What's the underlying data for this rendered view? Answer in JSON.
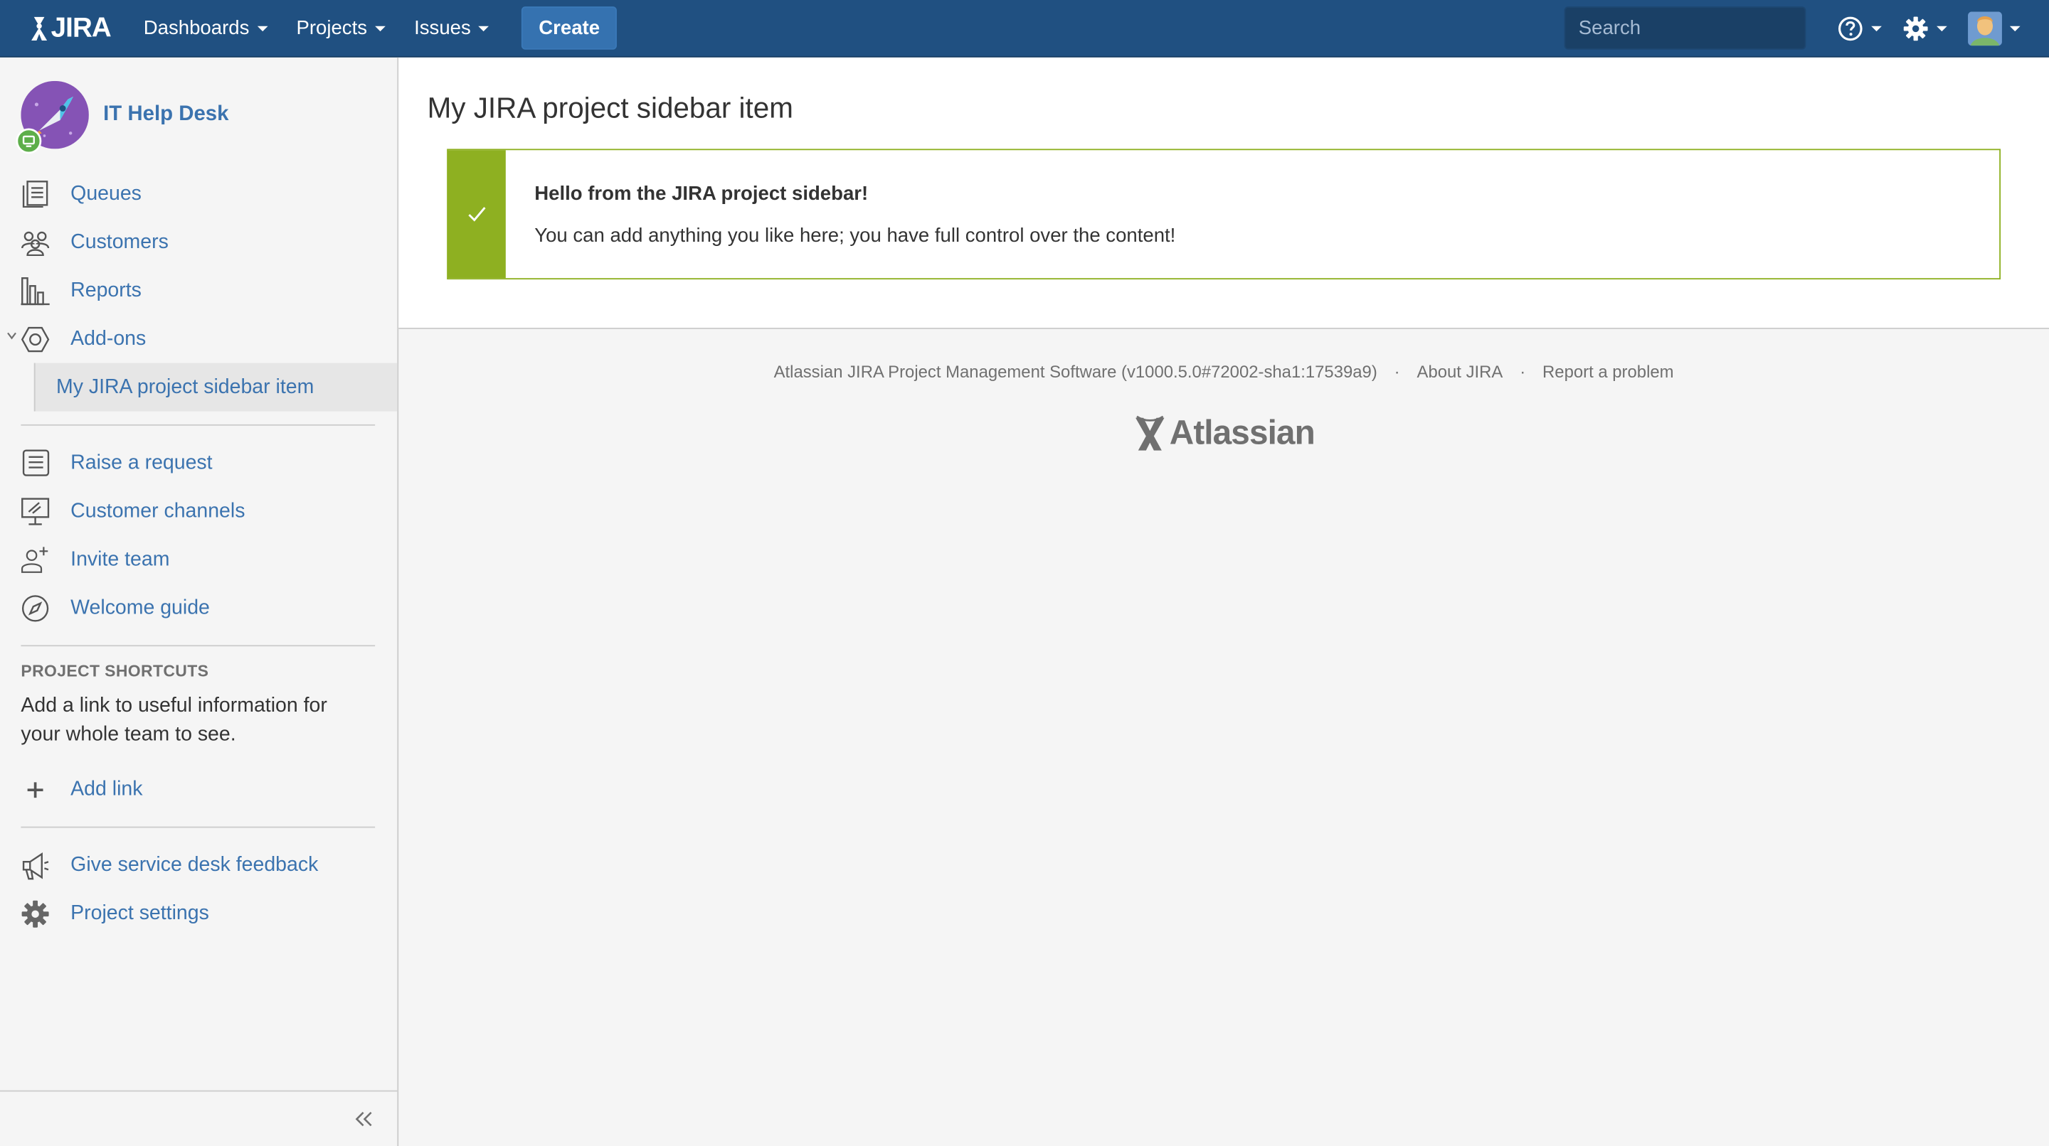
{
  "topnav": {
    "logo_text": "JIRA",
    "menus": [
      {
        "label": "Dashboards"
      },
      {
        "label": "Projects"
      },
      {
        "label": "Issues"
      }
    ],
    "create_label": "Create",
    "search_placeholder": "Search",
    "colors": {
      "bar": "#205081",
      "create": "#3572b0"
    }
  },
  "sidebar": {
    "project_name": "IT Help Desk",
    "items": [
      {
        "label": "Queues",
        "icon": "queues-icon"
      },
      {
        "label": "Customers",
        "icon": "customers-icon"
      },
      {
        "label": "Reports",
        "icon": "reports-icon"
      },
      {
        "label": "Add-ons",
        "icon": "addons-icon"
      }
    ],
    "active_sub_item": "My JIRA project sidebar item",
    "secondary_items": [
      {
        "label": "Raise a request",
        "icon": "raise-request-icon"
      },
      {
        "label": "Customer channels",
        "icon": "customer-channels-icon"
      },
      {
        "label": "Invite team",
        "icon": "invite-team-icon"
      },
      {
        "label": "Welcome guide",
        "icon": "compass-icon"
      }
    ],
    "shortcuts": {
      "heading": "PROJECT SHORTCUTS",
      "description": "Add a link to useful information for your whole team to see.",
      "add_link_label": "Add link"
    },
    "footer_items": [
      {
        "label": "Give service desk feedback",
        "icon": "megaphone-icon"
      },
      {
        "label": "Project settings",
        "icon": "gear-icon"
      }
    ]
  },
  "main": {
    "title": "My JIRA project sidebar item",
    "message": {
      "title": "Hello from the JIRA project sidebar!",
      "body": "You can add anything you like here; you have full control over the content!",
      "color": "#8eb021"
    }
  },
  "footer": {
    "version_text": "Atlassian JIRA Project Management Software (v1000.5.0#72002-sha1:17539a9)",
    "about_label": "About JIRA",
    "report_label": "Report a problem",
    "brand": "Atlassian"
  }
}
